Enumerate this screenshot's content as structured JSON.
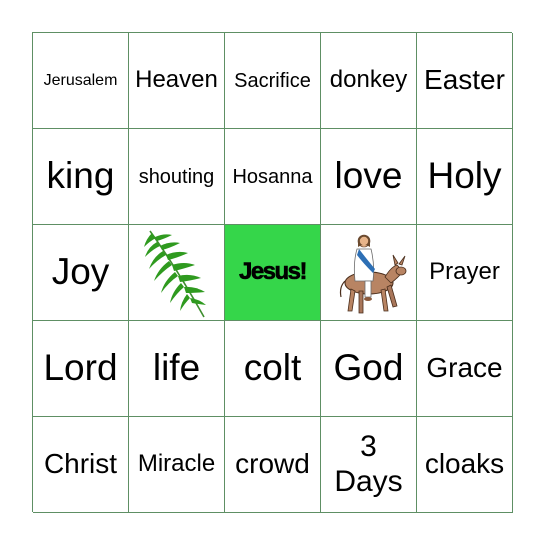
{
  "board": {
    "border_color": "#5e8f64",
    "free_space_color": "#35d64a",
    "rows": [
      [
        {
          "text": "Jerusalem",
          "size": "xs"
        },
        {
          "text": "Heaven",
          "size": "m"
        },
        {
          "text": "Sacrifice",
          "size": "s"
        },
        {
          "text": "donkey",
          "size": "m"
        },
        {
          "text": "Easter",
          "size": "l"
        }
      ],
      [
        {
          "text": "king",
          "size": "xl"
        },
        {
          "text": "shouting",
          "size": "s"
        },
        {
          "text": "Hosanna",
          "size": "s"
        },
        {
          "text": "love",
          "size": "xl"
        },
        {
          "text": "Holy",
          "size": "xl"
        }
      ],
      [
        {
          "text": "Joy",
          "size": "xl"
        },
        {
          "image": "palm-branch"
        },
        {
          "text": "Jesus!",
          "free": true
        },
        {
          "image": "jesus-on-donkey"
        },
        {
          "text": "Prayer",
          "size": "m"
        }
      ],
      [
        {
          "text": "Lord",
          "size": "xl"
        },
        {
          "text": "life",
          "size": "xl"
        },
        {
          "text": "colt",
          "size": "xl"
        },
        {
          "text": "God",
          "size": "xl"
        },
        {
          "text": "Grace",
          "size": "l"
        }
      ],
      [
        {
          "text": "Christ",
          "size": "l"
        },
        {
          "text": "Miracle",
          "size": "m"
        },
        {
          "text": "crowd",
          "size": "l"
        },
        {
          "line1": "3",
          "line2": "Days"
        },
        {
          "text": "cloaks",
          "size": "l"
        }
      ]
    ]
  }
}
